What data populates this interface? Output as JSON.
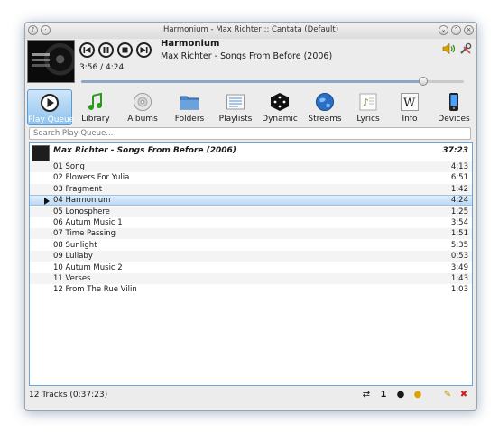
{
  "window": {
    "title": "Harmonium - Max Richter :: Cantata (Default)"
  },
  "player": {
    "track_title": "Harmonium",
    "track_artist_album": "Max Richter - Songs From Before (2006)",
    "time": "3:56 / 4:24",
    "progress": 0.894
  },
  "tabs": [
    {
      "label": "Play Queue",
      "icon": "play-queue-icon",
      "active": true
    },
    {
      "label": "Library",
      "icon": "music-note-icon",
      "active": false
    },
    {
      "label": "Albums",
      "icon": "disc-icon",
      "active": false
    },
    {
      "label": "Folders",
      "icon": "folder-icon",
      "active": false
    },
    {
      "label": "Playlists",
      "icon": "playlist-icon",
      "active": false
    },
    {
      "label": "Dynamic",
      "icon": "dice-icon",
      "active": false
    },
    {
      "label": "Streams",
      "icon": "globe-icon",
      "active": false
    },
    {
      "label": "Lyrics",
      "icon": "lyrics-icon",
      "active": false
    },
    {
      "label": "Info",
      "icon": "wikipedia-icon",
      "active": false
    },
    {
      "label": "Devices",
      "icon": "device-icon",
      "active": false
    }
  ],
  "search": {
    "placeholder": "Search Play Queue..."
  },
  "queue": {
    "album_header": "Max Richter - Songs From Before (2006)",
    "album_duration": "37:23",
    "tracks": [
      {
        "name": "01 Song",
        "duration": "4:13"
      },
      {
        "name": "02 Flowers For Yulia",
        "duration": "6:51"
      },
      {
        "name": "03 Fragment",
        "duration": "1:42"
      },
      {
        "name": "04 Harmonium",
        "duration": "4:24"
      },
      {
        "name": "05 Lonosphere",
        "duration": "1:25"
      },
      {
        "name": "06 Autum Music 1",
        "duration": "3:54"
      },
      {
        "name": "07 Time Passing",
        "duration": "1:51"
      },
      {
        "name": "08 Sunlight",
        "duration": "5:35"
      },
      {
        "name": "09 Lullaby",
        "duration": "0:53"
      },
      {
        "name": "10 Autum Music 2",
        "duration": "3:49"
      },
      {
        "name": "11 Verses",
        "duration": "1:43"
      },
      {
        "name": "12 From The Rue Vilin",
        "duration": "1:03"
      }
    ],
    "current_index": 3
  },
  "status": {
    "summary": "12 Tracks (0:37:23)",
    "single_label": "1"
  },
  "colors": {
    "accent": "#8fc3ee",
    "selection": "#bcd8f2"
  }
}
